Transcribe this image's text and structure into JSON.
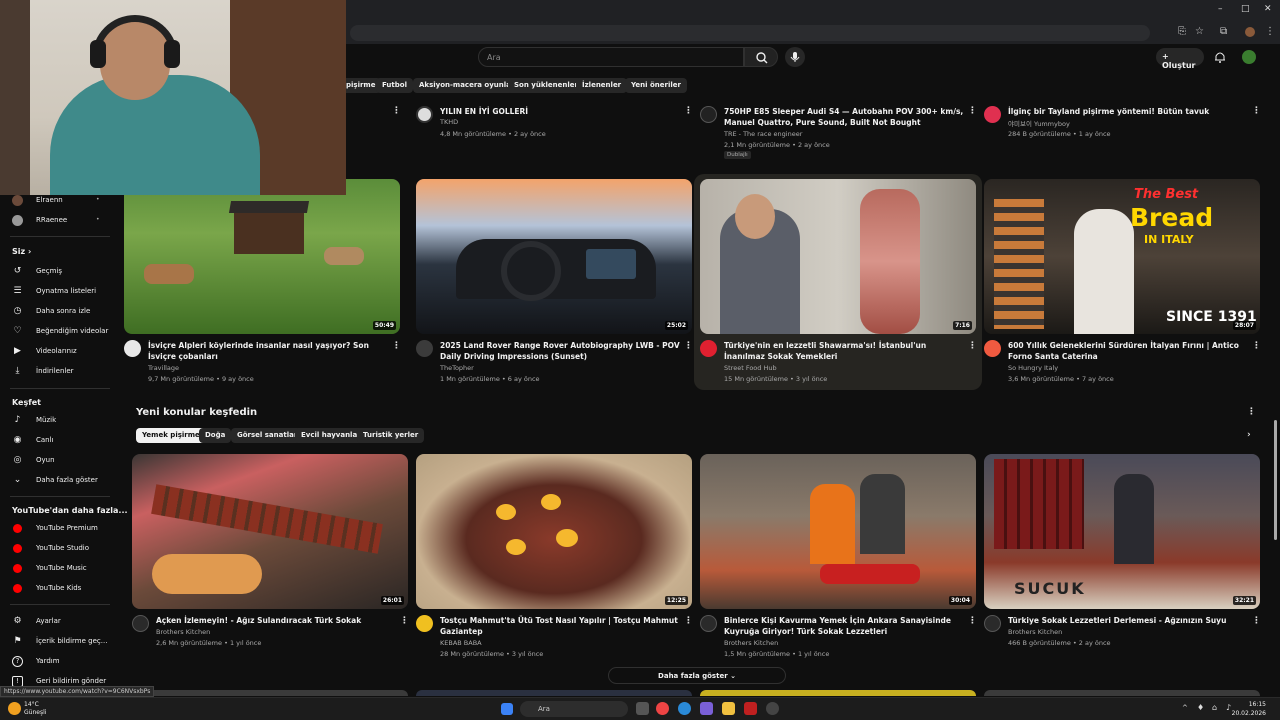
{
  "browser": {
    "window_controls": [
      "–",
      "□",
      "✕"
    ]
  },
  "header": {
    "search_placeholder": "Ara",
    "create_label": "Oluştur"
  },
  "chips_top": [
    {
      "label": "pişirme"
    },
    {
      "label": "Futbol"
    },
    {
      "label": "Aksiyon-macera oyunları"
    },
    {
      "label": "Son yüklenenler"
    },
    {
      "label": "İzlenenler"
    },
    {
      "label": "Yeni öneriler"
    }
  ],
  "sidebar": {
    "subs": [
      {
        "label": "Elraenn",
        "icon": "avatar"
      },
      {
        "label": "RRaenee",
        "icon": "avatar"
      }
    ],
    "you_heading": "Siz",
    "you_items": [
      {
        "label": "Geçmiş",
        "icon": "history-icon",
        "glyph": "↺"
      },
      {
        "label": "Oynatma listeleri",
        "icon": "playlist-icon",
        "glyph": "☰"
      },
      {
        "label": "Daha sonra izle",
        "icon": "clock-icon",
        "glyph": "◷"
      },
      {
        "label": "Beğendiğim videolar",
        "icon": "thumbs-up-icon",
        "glyph": "👍"
      },
      {
        "label": "Videolarınız",
        "icon": "video-icon",
        "glyph": "▶"
      },
      {
        "label": "İndirilenler",
        "icon": "download-icon",
        "glyph": "⤓"
      }
    ],
    "explore_heading": "Keşfet",
    "explore_items": [
      {
        "label": "Müzik",
        "icon": "music-icon",
        "glyph": "♪"
      },
      {
        "label": "Canlı",
        "icon": "live-icon",
        "glyph": "◉"
      },
      {
        "label": "Oyun",
        "icon": "gamepad-icon",
        "glyph": "◎"
      },
      {
        "label": "Daha fazla göster",
        "icon": "chevron-down-icon",
        "glyph": "⌄"
      }
    ],
    "more_heading": "YouTube'dan daha fazla...",
    "more_items": [
      {
        "label": "YouTube Premium",
        "icon": "youtube-premium-icon"
      },
      {
        "label": "YouTube Studio",
        "icon": "youtube-studio-icon"
      },
      {
        "label": "YouTube Music",
        "icon": "youtube-music-icon"
      },
      {
        "label": "YouTube Kids",
        "icon": "youtube-kids-icon"
      }
    ],
    "bottom_items": [
      {
        "label": "Ayarlar",
        "icon": "gear-icon",
        "glyph": "⚙"
      },
      {
        "label": "İçerik bildirme geç...",
        "icon": "flag-icon",
        "glyph": "⚑"
      },
      {
        "label": "Yardım",
        "icon": "help-icon",
        "glyph": "?"
      },
      {
        "label": "Geri bildirim gönder",
        "icon": "feedback-icon",
        "glyph": "!"
      }
    ]
  },
  "row0": [
    {
      "title": "YILIN EN İYİ GOLLERİ",
      "channel": "TKHD",
      "meta": "4,8 Mn görüntüleme • 2 ay önce"
    },
    {
      "title": "750HP E85 Sleeper Audi S4 — Autobahn POV 300+ km/s, Manuel Quattro, Pure Sound, Built Not Bought",
      "channel": "TRE - The race engineer",
      "meta": "2,1 Mn görüntüleme • 2 ay önce",
      "badge": "Dublajlı"
    },
    {
      "title": "İlginç bir Tayland pişirme yöntemi! Bütün tavuk kızartması",
      "channel": "야미보이 Yummyboy",
      "meta": "284 B görüntüleme • 1 ay önce"
    }
  ],
  "row1": [
    {
      "title": "İsviçre Alpleri köylerinde insanlar nasıl yaşıyor? Son İsviçre çobanları",
      "channel": "Travillage",
      "meta": "9,7 Mn görüntüleme • 9 ay önce",
      "duration": "50:49"
    },
    {
      "title": "2025 Land Rover Range Rover Autobiography LWB - POV Daily Driving Impressions (Sunset)",
      "channel": "TheTopher",
      "meta": "1 Mn görüntüleme • 6 ay önce",
      "duration": "25:02"
    },
    {
      "title": "Türkiye'nin en lezzetli Shawarma'sı! İstanbul'un İnanılmaz Sokak Yemekleri",
      "channel": "Street Food Hub",
      "meta": "15 Mn görüntüleme • 3 yıl önce",
      "duration": "7:16"
    },
    {
      "title": "600 Yıllık Geleneklerini Sürdüren İtalyan Fırını | Antico Forno Santa Caterina",
      "channel": "So Hungry Italy",
      "meta": "3,6 Mn görüntüleme • 7 ay önce",
      "duration": "28:07",
      "thumb_text": [
        "The Best",
        "Bread",
        "IN ITALY",
        "SINCE 1391"
      ]
    }
  ],
  "section": {
    "title": "Yeni konular keşfedin",
    "chips": [
      "Yemek pişirme",
      "Doğa",
      "Görsel sanatlar",
      "Evcil hayvanlar",
      "Turistik yerler"
    ]
  },
  "row2": [
    {
      "title": "Açken İzlemeyin! - Ağız Sulandıracak Türk Sokak Lezzetleri",
      "channel": "Brothers Kitchen",
      "meta": "2,6 Mn görüntüleme • 1 yıl önce",
      "duration": "26:01"
    },
    {
      "title": "Tostçu Mahmut'ta Ütü Tost Nasıl Yapılır | Tostçu Mahmut Gaziantep",
      "channel": "KEBAB BABA",
      "meta": "28 Mn görüntüleme • 3 yıl önce",
      "duration": "12:25"
    },
    {
      "title": "Binlerce Kişi Kavurma Yemek İçin Ankara Sanayisinde Kuyruğa Giriyor! Türk Sokak Lezzetleri",
      "channel": "Brothers Kitchen",
      "meta": "1,5 Mn görüntüleme • 1 yıl önce",
      "duration": "30:04"
    },
    {
      "title": "Türkiye Sokak Lezzetleri Derlemesi - Ağzınızın Suyu Akabilir 🤤",
      "channel": "Brothers Kitchen",
      "meta": "466 B görüntüleme • 2 ay önce",
      "duration": "32:21",
      "thumb_text": [
        "SUCUK"
      ]
    }
  ],
  "more_label": "Daha fazla göster",
  "status_url": "https://www.youtube.com/watch?v=9C6NVsxbPs",
  "taskbar": {
    "search": "Ara",
    "weather_temp": "14°C",
    "weather_desc": "Güneşli",
    "time": "16:15",
    "date": "20.02.2026"
  },
  "colors": {
    "bg": "#0f0f0f",
    "accent_red": "#ff0000",
    "highlight": "#262521"
  }
}
